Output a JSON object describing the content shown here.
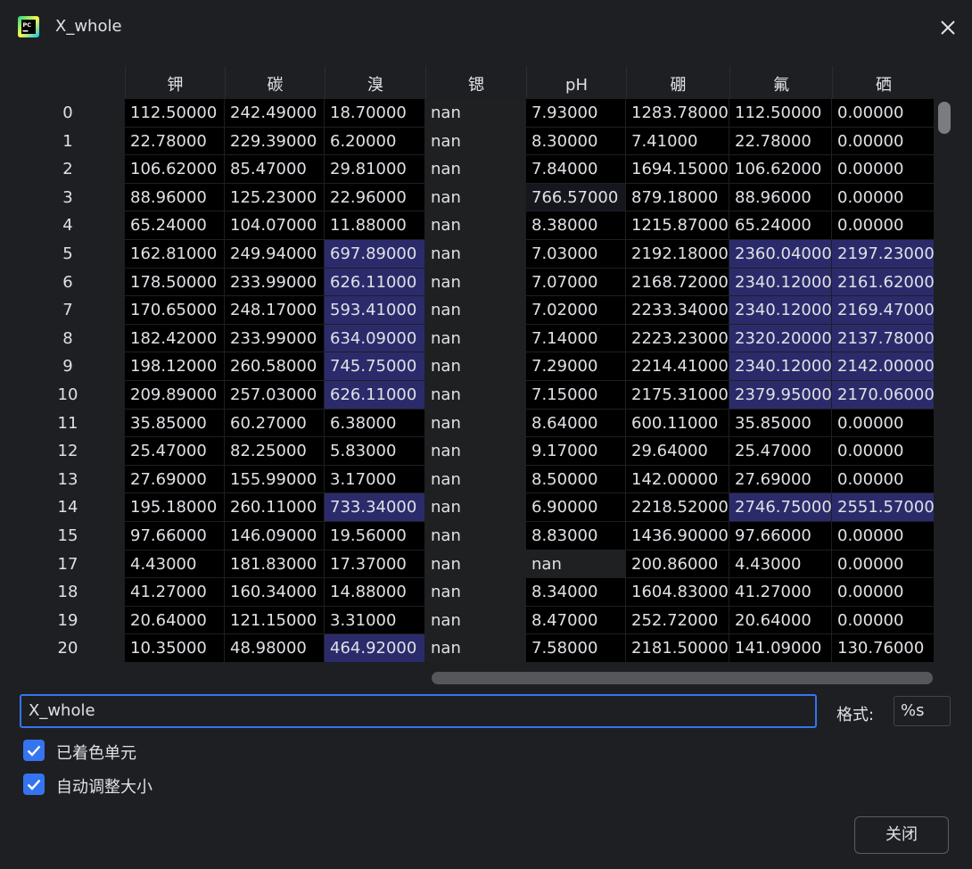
{
  "window": {
    "title": "X_whole",
    "app_icon": "pycharm-icon",
    "close_icon": "close-icon"
  },
  "table": {
    "columns": [
      "钾",
      "碳",
      "溴",
      "锶",
      "pH",
      "硼",
      "氟",
      "硒"
    ],
    "rows": [
      {
        "index": "0",
        "cells": [
          "112.50000",
          "242.49000",
          "18.70000",
          "nan",
          "7.93000",
          "1283.78000",
          "112.50000",
          "0.00000"
        ]
      },
      {
        "index": "1",
        "cells": [
          "22.78000",
          "229.39000",
          "6.20000",
          "nan",
          "8.30000",
          "7.41000",
          "22.78000",
          "0.00000"
        ]
      },
      {
        "index": "2",
        "cells": [
          "106.62000",
          "85.47000",
          "29.81000",
          "nan",
          "7.84000",
          "1694.15000",
          "106.62000",
          "0.00000"
        ]
      },
      {
        "index": "3",
        "cells": [
          "88.96000",
          "125.23000",
          "22.96000",
          "nan",
          "766.57000",
          "879.18000",
          "88.96000",
          "0.00000"
        ]
      },
      {
        "index": "4",
        "cells": [
          "65.24000",
          "104.07000",
          "11.88000",
          "nan",
          "8.38000",
          "1215.87000",
          "65.24000",
          "0.00000"
        ]
      },
      {
        "index": "5",
        "cells": [
          "162.81000",
          "249.94000",
          "697.89000",
          "nan",
          "7.03000",
          "2192.18000",
          "2360.04000",
          "2197.23000"
        ]
      },
      {
        "index": "6",
        "cells": [
          "178.50000",
          "233.99000",
          "626.11000",
          "nan",
          "7.07000",
          "2168.72000",
          "2340.12000",
          "2161.62000"
        ]
      },
      {
        "index": "7",
        "cells": [
          "170.65000",
          "248.17000",
          "593.41000",
          "nan",
          "7.02000",
          "2233.34000",
          "2340.12000",
          "2169.47000"
        ]
      },
      {
        "index": "8",
        "cells": [
          "182.42000",
          "233.99000",
          "634.09000",
          "nan",
          "7.14000",
          "2223.23000",
          "2320.20000",
          "2137.78000"
        ]
      },
      {
        "index": "9",
        "cells": [
          "198.12000",
          "260.58000",
          "745.75000",
          "nan",
          "7.29000",
          "2214.41000",
          "2340.12000",
          "2142.00000"
        ]
      },
      {
        "index": "10",
        "cells": [
          "209.89000",
          "257.03000",
          "626.11000",
          "nan",
          "7.15000",
          "2175.31000",
          "2379.95000",
          "2170.06000"
        ]
      },
      {
        "index": "11",
        "cells": [
          "35.85000",
          "60.27000",
          "6.38000",
          "nan",
          "8.64000",
          "600.11000",
          "35.85000",
          "0.00000"
        ]
      },
      {
        "index": "12",
        "cells": [
          "25.47000",
          "82.25000",
          "5.83000",
          "nan",
          "9.17000",
          "29.64000",
          "25.47000",
          "0.00000"
        ]
      },
      {
        "index": "13",
        "cells": [
          "27.69000",
          "155.99000",
          "3.17000",
          "nan",
          "8.50000",
          "142.00000",
          "27.69000",
          "0.00000"
        ]
      },
      {
        "index": "14",
        "cells": [
          "195.18000",
          "260.11000",
          "733.34000",
          "nan",
          "6.90000",
          "2218.52000",
          "2746.75000",
          "2551.57000"
        ]
      },
      {
        "index": "15",
        "cells": [
          "97.66000",
          "146.09000",
          "19.56000",
          "nan",
          "8.83000",
          "1436.90000",
          "97.66000",
          "0.00000"
        ]
      },
      {
        "index": "17",
        "cells": [
          "4.43000",
          "181.83000",
          "17.37000",
          "nan",
          "nan",
          "200.86000",
          "4.43000",
          "0.00000"
        ]
      },
      {
        "index": "18",
        "cells": [
          "41.27000",
          "160.34000",
          "14.88000",
          "nan",
          "8.34000",
          "1604.83000",
          "41.27000",
          "0.00000"
        ]
      },
      {
        "index": "19",
        "cells": [
          "20.64000",
          "121.15000",
          "3.31000",
          "nan",
          "8.47000",
          "252.72000",
          "20.64000",
          "0.00000"
        ]
      },
      {
        "index": "20",
        "cells": [
          "10.35000",
          "48.98000",
          "464.92000",
          "nan",
          "7.58000",
          "2181.50000",
          "141.09000",
          "130.76000"
        ]
      }
    ],
    "colors": {
      "normal": "#000000",
      "highlight": "#2b2b6b",
      "nan_bg": "#1f2022"
    }
  },
  "name_field": {
    "value": "X_whole"
  },
  "format": {
    "label": "格式:",
    "value": "%s"
  },
  "checkboxes": [
    {
      "label": "已着色单元",
      "checked": true
    },
    {
      "label": "自动调整大小",
      "checked": true
    }
  ],
  "close_button": {
    "label": "关闭"
  },
  "accent_color": "#3574f0"
}
